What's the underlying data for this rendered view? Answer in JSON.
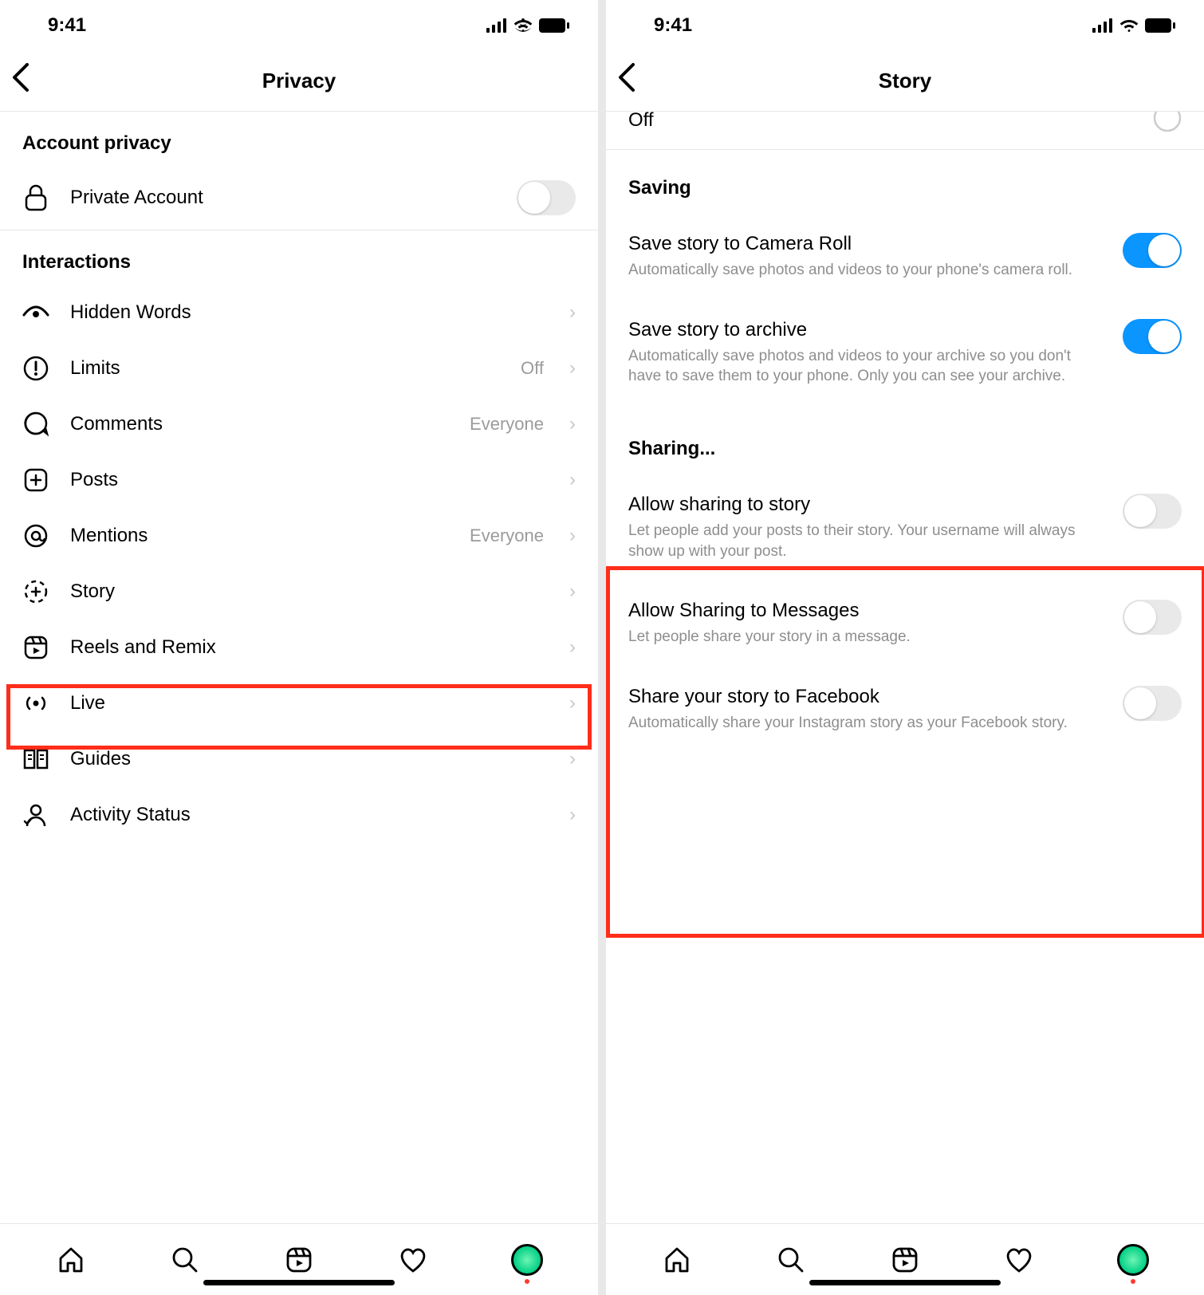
{
  "status": {
    "time": "9:41"
  },
  "left": {
    "title": "Privacy",
    "sections": {
      "account_privacy": "Account privacy",
      "private_account": "Private Account",
      "interactions": "Interactions"
    },
    "items": [
      {
        "key": "hidden-words",
        "label": "Hidden Words",
        "value": ""
      },
      {
        "key": "limits",
        "label": "Limits",
        "value": "Off"
      },
      {
        "key": "comments",
        "label": "Comments",
        "value": "Everyone"
      },
      {
        "key": "posts",
        "label": "Posts",
        "value": ""
      },
      {
        "key": "mentions",
        "label": "Mentions",
        "value": "Everyone"
      },
      {
        "key": "story",
        "label": "Story",
        "value": ""
      },
      {
        "key": "reels",
        "label": "Reels and Remix",
        "value": ""
      },
      {
        "key": "live",
        "label": "Live",
        "value": ""
      },
      {
        "key": "guides",
        "label": "Guides",
        "value": ""
      },
      {
        "key": "activity",
        "label": "Activity Status",
        "value": ""
      }
    ]
  },
  "right": {
    "title": "Story",
    "partial_off": "Off",
    "saving_header": "Saving",
    "sharing_header": "Sharing...",
    "settings": {
      "save_camera": {
        "label": "Save story to Camera Roll",
        "desc": "Automatically save photos and videos to your phone's camera roll.",
        "on": true
      },
      "save_archive": {
        "label": "Save story to archive",
        "desc": "Automatically save photos and videos to your archive so you don't have to save them to your phone. Only you can see your archive.",
        "on": true
      },
      "allow_story": {
        "label": "Allow sharing to story",
        "desc": "Let people add your posts to their story. Your username will always show up with your post.",
        "on": false
      },
      "allow_messages": {
        "label": "Allow Sharing to Messages",
        "desc": "Let people share your story in a message.",
        "on": false
      },
      "share_fb": {
        "label": "Share your story to Facebook",
        "desc": "Automatically share your Instagram story as your Facebook story.",
        "on": false
      }
    }
  }
}
